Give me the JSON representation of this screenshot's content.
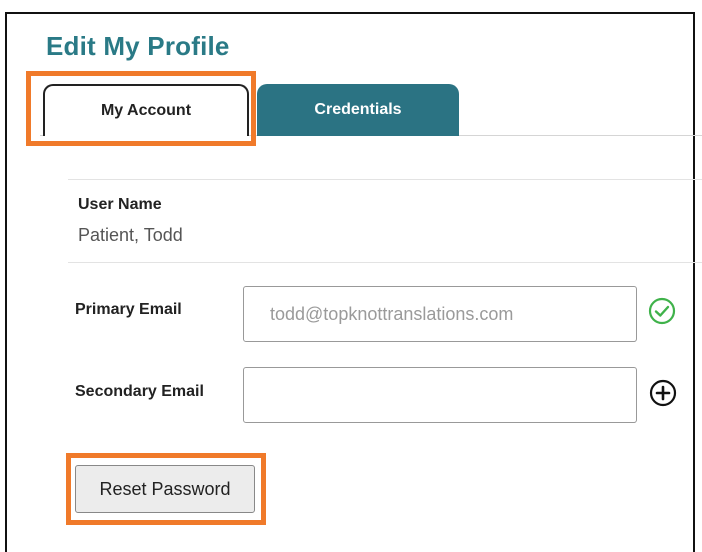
{
  "page": {
    "title": "Edit My Profile"
  },
  "tabs": [
    {
      "label": "My Account",
      "active": true
    },
    {
      "label": "Credentials",
      "active": false
    }
  ],
  "account": {
    "username_label": "User Name",
    "username_value": "Patient, Todd",
    "primary_email": {
      "label": "Primary Email",
      "value": "todd@topknottranslations.com",
      "status_icon": "check-circle-icon"
    },
    "secondary_email": {
      "label": "Secondary Email",
      "value": "",
      "action_icon": "plus-circle-icon"
    },
    "reset_button_label": "Reset Password"
  },
  "colors": {
    "title": "#2a7a86",
    "tab_inactive_bg": "#2b7383",
    "highlight": "#f07a2a",
    "check": "#3fb24a"
  }
}
